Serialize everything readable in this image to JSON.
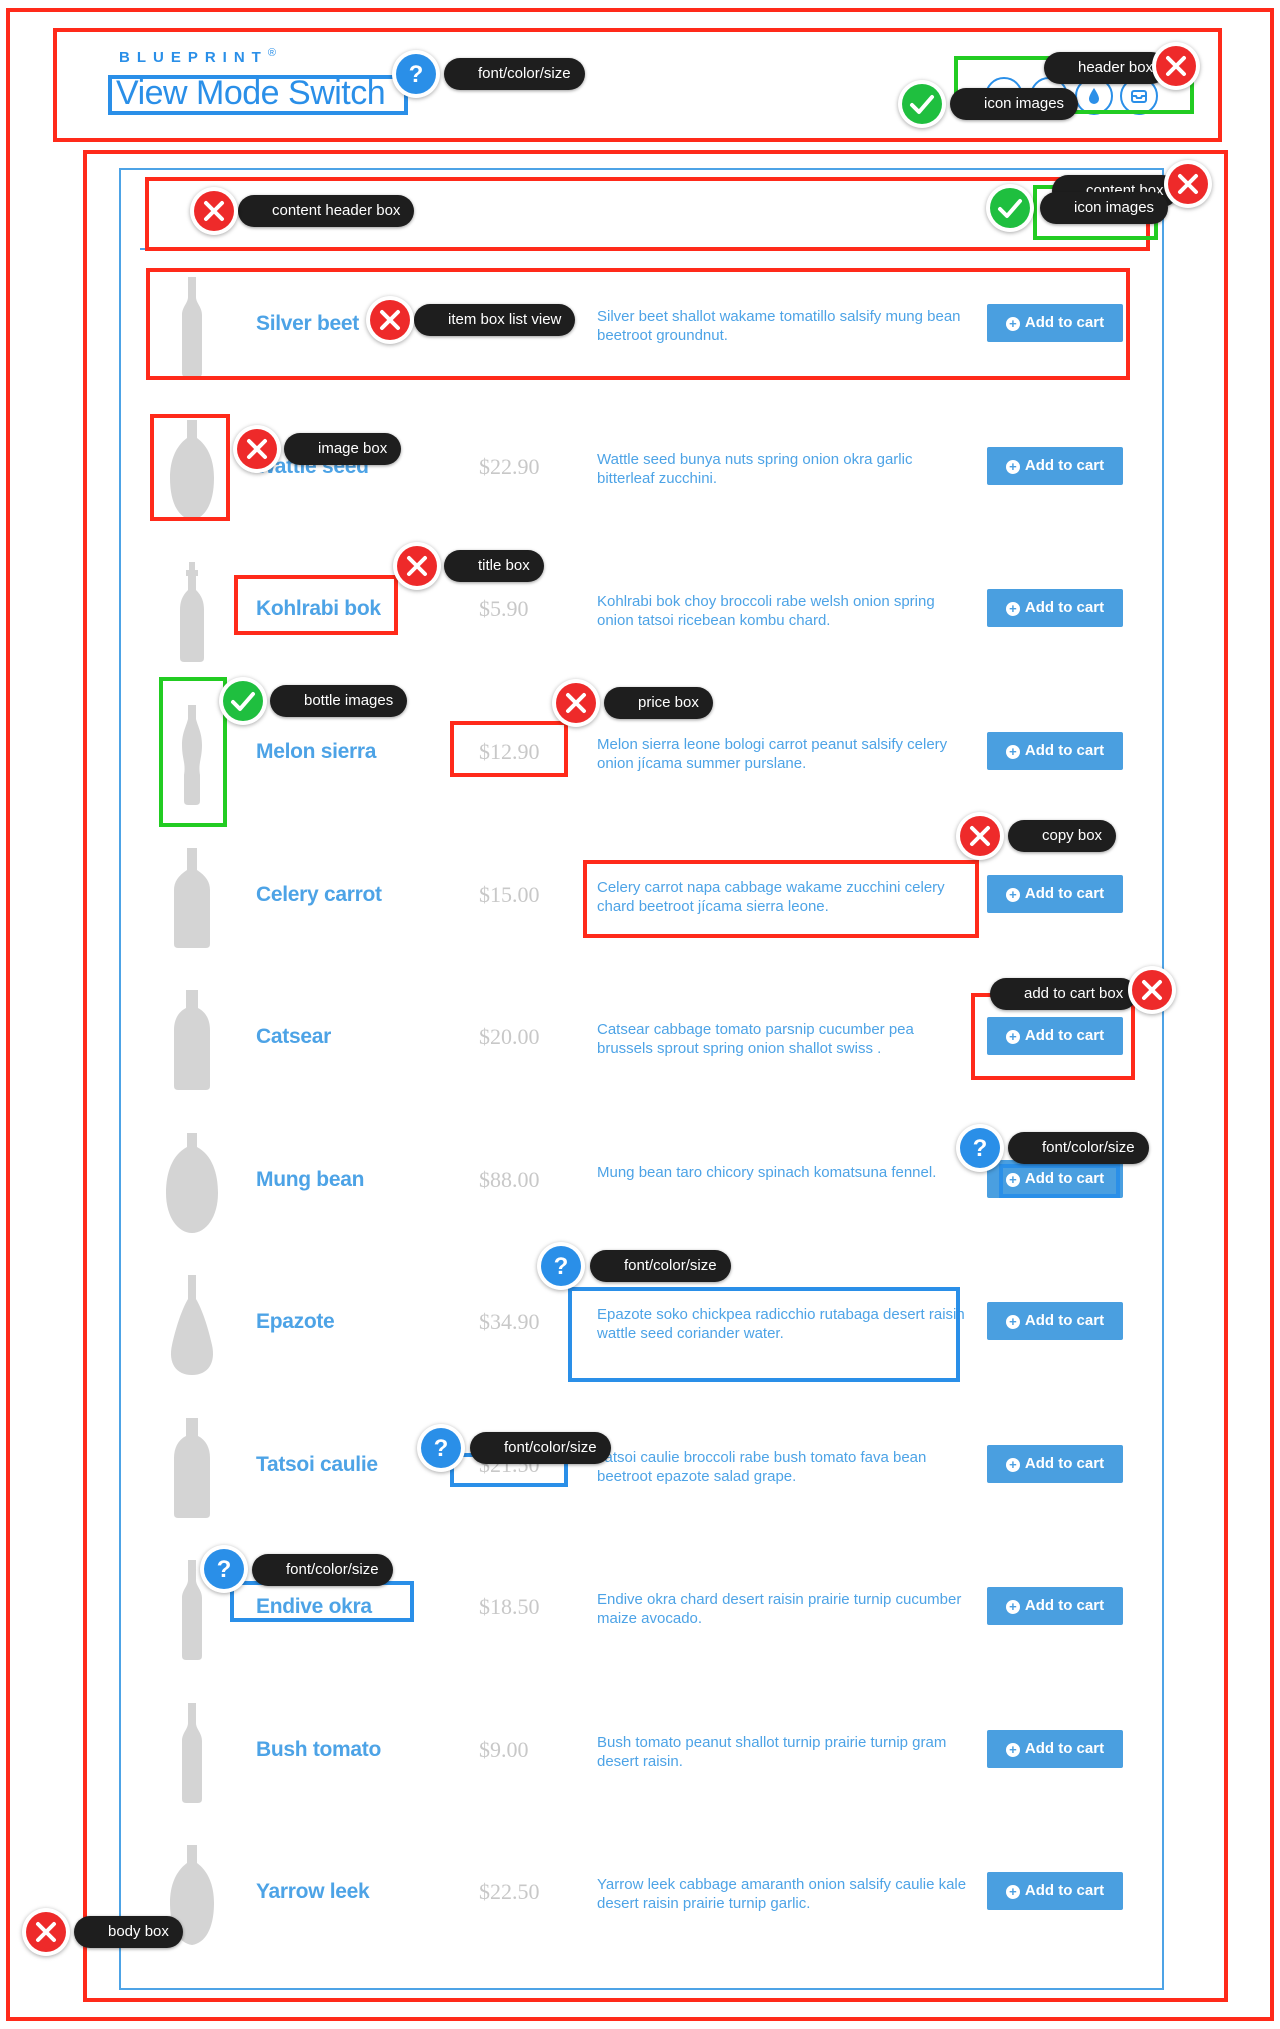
{
  "brand": {
    "name": "BLUEPRINT",
    "mark": "®"
  },
  "page_title": "View Mode Switch",
  "colors": {
    "accent": "#2a8fe8",
    "error": "#ff2a1a",
    "ok": "#22cc22",
    "muted": "#c8c8c8"
  },
  "header_icons": [
    "circle-icon",
    "circle-icon",
    "drop-icon",
    "box-icon"
  ],
  "products": [
    {
      "title": "Silver beet",
      "price": "",
      "desc": "Silver beet shallot wakame tomatillo salsify mung bean beetroot groundnut.",
      "cart": "Add to cart",
      "bottle": "tall"
    },
    {
      "title": "Wattle seed",
      "price": "$22.90",
      "desc": "Wattle seed bunya nuts spring onion okra garlic bitterleaf zucchini.",
      "cart": "Add to cart",
      "bottle": "shield"
    },
    {
      "title": "Kohlrabi bok",
      "price": "$5.90",
      "desc": "Kohlrabi bok choy broccoli rabe welsh onion spring onion tatsoi ricebean kombu chard.",
      "cart": "Add to cart",
      "bottle": "swing"
    },
    {
      "title": "Melon sierra",
      "price": "$12.90",
      "desc": "Melon sierra leone bologi carrot peanut salsify celery onion jícama summer purslane.",
      "cart": "Add to cart",
      "bottle": "soda"
    },
    {
      "title": "Celery carrot",
      "price": "$15.00",
      "desc": "Celery carrot napa cabbage wakame zucchini celery chard beetroot jícama sierra leone.",
      "cart": "Add to cart",
      "bottle": "square"
    },
    {
      "title": "Catsear",
      "price": "$20.00",
      "desc": "Catsear cabbage tomato parsnip cucumber pea brussels sprout spring onion shallot swiss .",
      "cart": "Add to cart",
      "bottle": "whisky"
    },
    {
      "title": "Mung bean",
      "price": "$88.00",
      "desc": "Mung bean taro chicory spinach komatsuna fennel.",
      "cart": "Add to cart",
      "bottle": "round"
    },
    {
      "title": "Epazote",
      "price": "$34.90",
      "desc": "Epazote soko chickpea radicchio rutabaga desert raisin wattle seed coriander water.",
      "cart": "Add to cart",
      "bottle": "gourd"
    },
    {
      "title": "Tatsoi caulie",
      "price": "$21.50",
      "desc": "Tatsoi caulie broccoli rabe bush tomato fava bean beetroot epazote salad grape.",
      "cart": "Add to cart",
      "bottle": "whisky"
    },
    {
      "title": "Endive okra",
      "price": "$18.50",
      "desc": "Endive okra chard desert raisin prairie turnip cucumber maize avocado.",
      "cart": "Add to cart",
      "bottle": "tall"
    },
    {
      "title": "Bush tomato",
      "price": "$9.00",
      "desc": "Bush tomato peanut shallot turnip prairie turnip gram desert raisin.",
      "cart": "Add to cart",
      "bottle": "tall"
    },
    {
      "title": "Yarrow leek",
      "price": "$22.50",
      "desc": "Yarrow leek cabbage amaranth onion salsify caulie kale desert raisin prairie turnip garlic.",
      "cart": "Add to cart",
      "bottle": "shield"
    }
  ],
  "annotations": [
    {
      "label": "font/color/size",
      "status": "question"
    },
    {
      "label": "header box",
      "status": "fail"
    },
    {
      "label": "icon images",
      "status": "pass"
    },
    {
      "label": "content box",
      "status": "fail"
    },
    {
      "label": "content header box",
      "status": "fail"
    },
    {
      "label": "icon images",
      "status": "pass"
    },
    {
      "label": "item box list view",
      "status": "fail"
    },
    {
      "label": "image box",
      "status": "fail"
    },
    {
      "label": "title box",
      "status": "fail"
    },
    {
      "label": "bottle images",
      "status": "pass"
    },
    {
      "label": "price box",
      "status": "fail"
    },
    {
      "label": "copy box",
      "status": "fail"
    },
    {
      "label": "add to cart box",
      "status": "fail"
    },
    {
      "label": "font/color/size",
      "status": "question"
    },
    {
      "label": "font/color/size",
      "status": "question"
    },
    {
      "label": "font/color/size",
      "status": "question"
    },
    {
      "label": "font/color/size",
      "status": "question"
    },
    {
      "label": "body box",
      "status": "fail"
    }
  ]
}
